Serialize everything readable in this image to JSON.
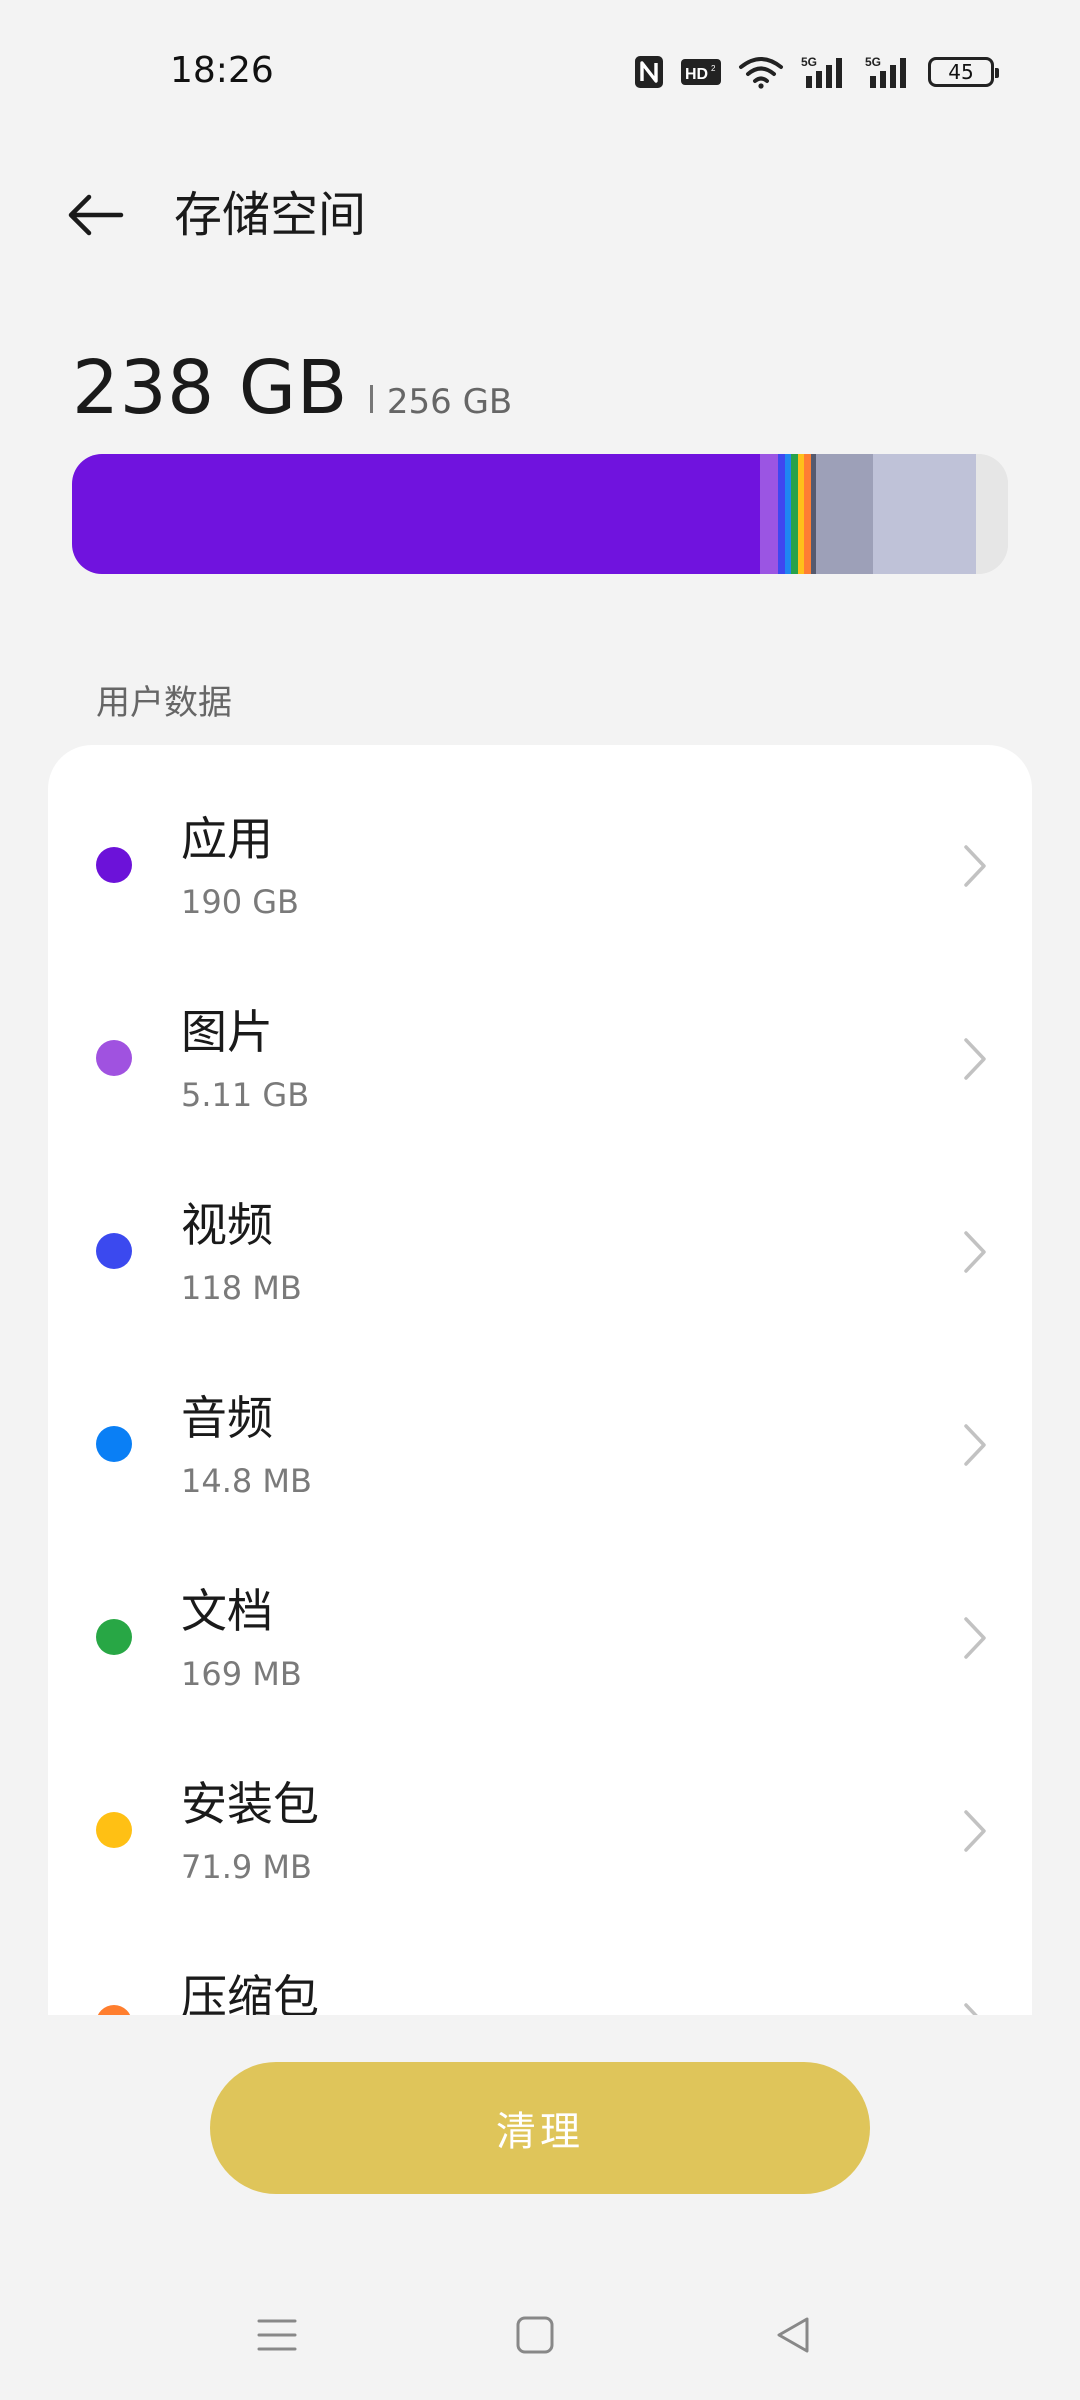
{
  "status": {
    "time": "18:26",
    "icons": [
      "nfc-icon",
      "hd-icon",
      "wifi-icon",
      "signal-5g-icon",
      "signal-5g-icon"
    ],
    "network_labels": [
      "5G",
      "5G"
    ],
    "battery": "45"
  },
  "header": {
    "title": "存储空间"
  },
  "summary": {
    "used": "238 GB",
    "total": "256 GB",
    "bar_segments": [
      {
        "category": "应用",
        "color": "#7013de",
        "percent": 74.2
      },
      {
        "category": "图片",
        "color": "#9b55e3",
        "percent": 2.0
      },
      {
        "category": "视频",
        "color": "#3f47f0",
        "percent": 0.7
      },
      {
        "category": "音频",
        "color": "#1f87f2",
        "percent": 0.7
      },
      {
        "category": "文档",
        "color": "#27a24a",
        "percent": 0.7
      },
      {
        "category": "安装包",
        "color": "#ffc01a",
        "percent": 0.7
      },
      {
        "category": "压缩包",
        "color": "#ff7e33",
        "percent": 0.7
      },
      {
        "category": "other",
        "color": "#555a6e",
        "percent": 0.6
      },
      {
        "category": "other",
        "color": "#9da0b8",
        "percent": 6.1
      },
      {
        "category": "other",
        "color": "#bfc2d8",
        "percent": 11.1
      },
      {
        "category": "free",
        "color": "#e6e6e6",
        "percent": 3.5
      }
    ]
  },
  "section": {
    "label": "用户数据"
  },
  "categories": [
    {
      "name": "应用",
      "size": "190 GB",
      "color": "#6c12d9"
    },
    {
      "name": "图片",
      "size": "5.11 GB",
      "color": "#a052e0"
    },
    {
      "name": "视频",
      "size": "118 MB",
      "color": "#3b49ef"
    },
    {
      "name": "音频",
      "size": "14.8 MB",
      "color": "#0a7ff5"
    },
    {
      "name": "文档",
      "size": "169 MB",
      "color": "#28a745"
    },
    {
      "name": "安装包",
      "size": "71.9 MB",
      "color": "#ffc014"
    },
    {
      "name": "压缩包",
      "size": "",
      "color": "#ff7e2e"
    }
  ],
  "action": {
    "clean_label": "清理",
    "color": "#dfc55a"
  },
  "nav": {
    "icons": [
      "menu-icon",
      "home-icon",
      "back-icon"
    ]
  }
}
